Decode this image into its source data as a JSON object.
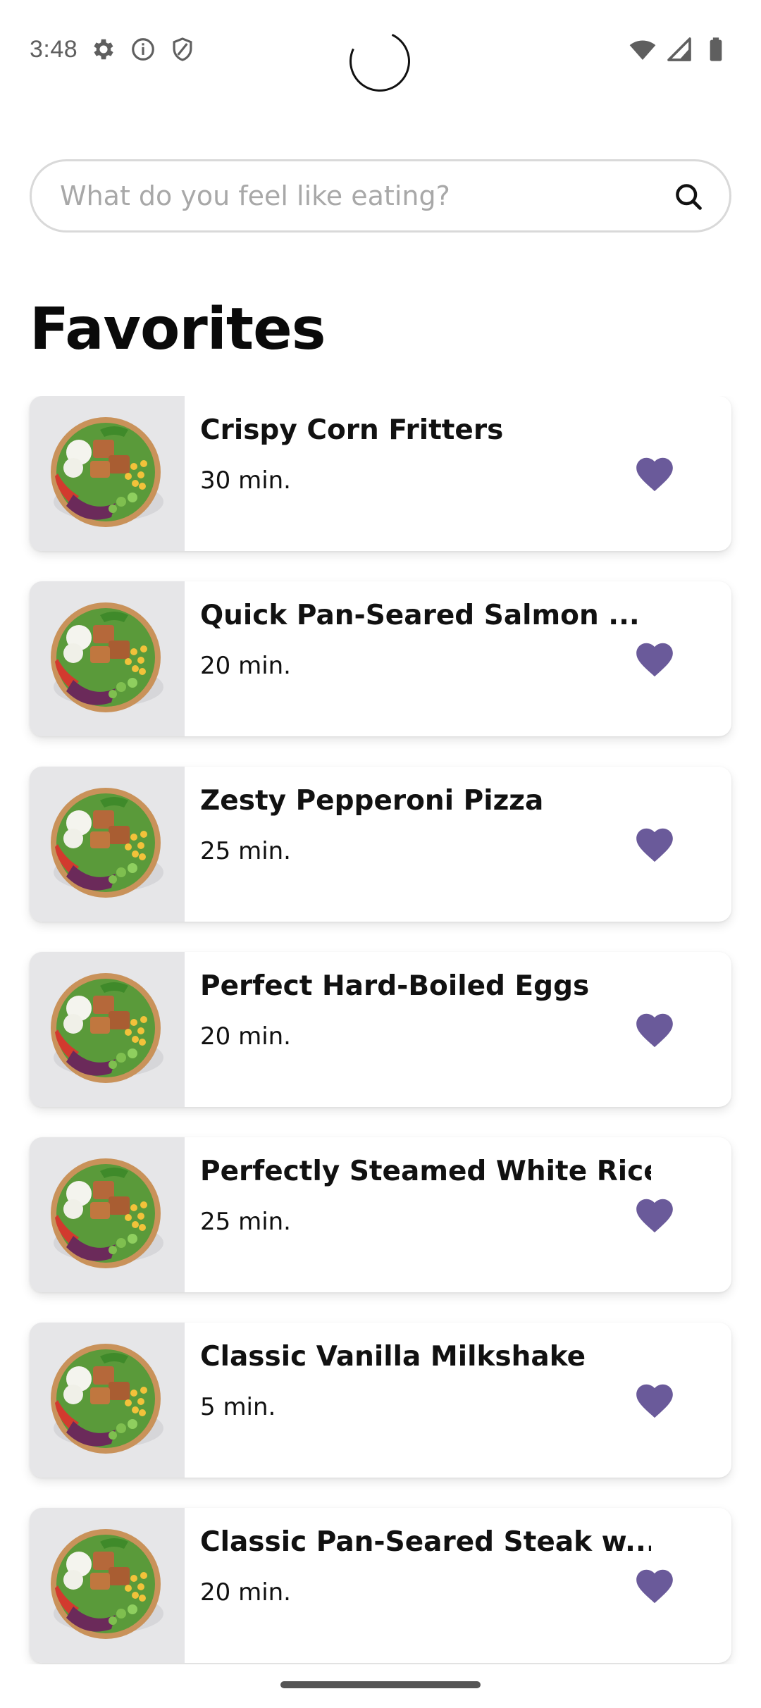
{
  "status_bar": {
    "time": "3:48",
    "left_icons": [
      "gear-icon",
      "info-icon",
      "shield-icon"
    ],
    "right_icons": [
      "wifi-icon",
      "signal-icon",
      "battery-icon"
    ]
  },
  "search": {
    "placeholder": "What do you feel like eating?",
    "value": ""
  },
  "page": {
    "title": "Favorites"
  },
  "colors": {
    "accent": "#6a5a9a",
    "text": "#111111",
    "placeholder": "#a8a8a8"
  },
  "favorites": [
    {
      "title": "Crispy Corn Fritters",
      "time": "30 min.",
      "favorited": true
    },
    {
      "title": "Quick Pan-Seared Salmon ...",
      "time": "20 min.",
      "favorited": true
    },
    {
      "title": "Zesty Pepperoni Pizza",
      "time": "25 min.",
      "favorited": true
    },
    {
      "title": "Perfect Hard-Boiled Eggs",
      "time": "20 min.",
      "favorited": true
    },
    {
      "title": "Perfectly Steamed White Rice",
      "time": "25 min.",
      "favorited": true
    },
    {
      "title": "Classic Vanilla Milkshake",
      "time": "5 min.",
      "favorited": true
    },
    {
      "title": "Classic Pan-Seared Steak w...",
      "time": "20 min.",
      "favorited": true
    }
  ]
}
